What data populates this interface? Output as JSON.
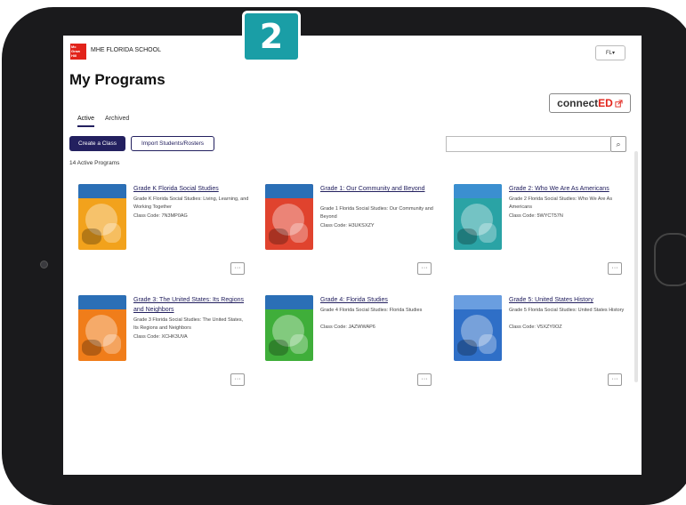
{
  "badge": "2",
  "header": {
    "logo_text": "Mc Graw Hill",
    "school": "MHE FLORIDA SCHOOL",
    "lang": "FL▾"
  },
  "page": {
    "title": "My Programs",
    "connected": {
      "a": "connect",
      "b": "ED",
      "icon": "external-link-icon"
    }
  },
  "tabs": [
    {
      "label": "Active",
      "active": true
    },
    {
      "label": "Archived",
      "active": false
    }
  ],
  "actions": {
    "create": "Create a Class",
    "import": "Import Students/Rosters",
    "search_icon": "⌕"
  },
  "count": "14 Active Programs",
  "programs": [
    {
      "title": "Grade K Florida Social Studies",
      "desc": "Grade K Florida Social Studies: Living, Learning, and Working Together",
      "code": "Class Code: 7N3MP0AG",
      "color": "#f2a21c",
      "band": "#2b6fb6"
    },
    {
      "title": "Grade 1: Our Community and Beyond",
      "desc": "Grade 1 Florida Social Studies: Our Community and Beyond",
      "code": "Class Code: H3UKSXZY",
      "color": "#e0432e",
      "band": "#2b6fb6"
    },
    {
      "title": "Grade 2: Who We Are As Americans",
      "desc": "Grade 2 Florida Social Studies: Who We Are As Americans",
      "code": "Class Code: 5WYCT57N",
      "color": "#2aa3a5",
      "band": "#3b8fd0"
    },
    {
      "title": "Grade 3: The United States: Its Regions and Neighbors",
      "desc": "Grade 3 Florida Social Studies: The United States, Its Regions and Neighbors",
      "code": "Class Code: XCHK3UVA",
      "color": "#f07d1a",
      "band": "#2b6fb6"
    },
    {
      "title": "Grade 4: Florida Studies",
      "desc": "Grade 4 Florida Social Studies: Florida Studies",
      "code": "Class Code: JAZWWAP6",
      "color": "#3fae3a",
      "band": "#2b6fb6"
    },
    {
      "title": "Grade 5: United States History",
      "desc": "Grade 5 Florida Social Studies: United States History",
      "code": "Class Code: V5XZY0OZ",
      "color": "#2f6fc7",
      "band": "#6a9ee0"
    }
  ],
  "more_label": "···"
}
